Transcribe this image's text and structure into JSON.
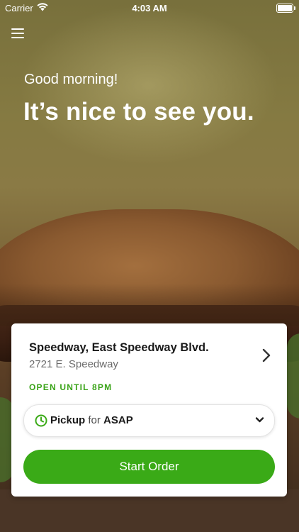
{
  "status_bar": {
    "carrier": "Carrier",
    "time": "4:03 AM"
  },
  "header": {
    "greeting": "Good morning!",
    "headline": "It’s nice to see you."
  },
  "store": {
    "name": "Speedway, East Speedway Blvd.",
    "address": "2721 E. Speedway",
    "open_status": "OPEN UNTIL 8PM"
  },
  "order_mode": {
    "mode": "Pickup",
    "connector": "for",
    "time": "ASAP"
  },
  "start_order_label": "Start Order",
  "colors": {
    "accent_green": "#3aaa17",
    "open_status_green": "#3aa318",
    "clock_green": "#3aaa17"
  },
  "icons": [
    "wifi-icon",
    "battery-icon",
    "hamburger-menu-icon",
    "chevron-right-icon",
    "clock-icon",
    "chevron-down-icon"
  ]
}
